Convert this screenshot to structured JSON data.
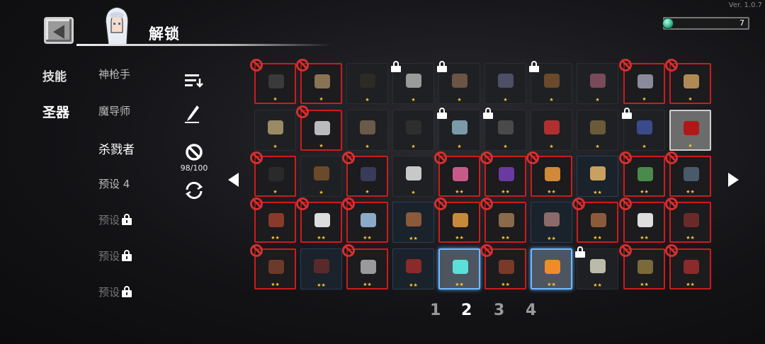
{
  "version": "Ver. 1.0.7",
  "header": {
    "title": "解锁"
  },
  "currency": {
    "count": "7"
  },
  "categories": [
    {
      "label": "技能",
      "active": false
    },
    {
      "label": "圣器",
      "active": true
    }
  ],
  "presets": [
    {
      "label": "神枪手",
      "locked": false
    },
    {
      "label": "魔导师",
      "locked": false
    },
    {
      "label": "杀戮者",
      "locked": false,
      "active": true
    },
    {
      "label": "预设 4",
      "locked": false
    },
    {
      "label": "预设",
      "locked": true
    },
    {
      "label": "预设",
      "locked": true
    },
    {
      "label": "预设",
      "locked": true
    }
  ],
  "tools": {
    "ban_count": "98/100"
  },
  "pages": [
    "1",
    "2",
    "3",
    "4"
  ],
  "active_page": "2",
  "grid": {
    "rows": [
      [
        {
          "state": "banned",
          "stars": "★",
          "color": "#3a3a3a",
          "icon": "helmet-icon"
        },
        {
          "state": "banned",
          "stars": "★",
          "color": "#8a7355",
          "icon": "horn-icon"
        },
        {
          "state": "normal",
          "stars": "★",
          "color": "#2e2a24",
          "icon": "necklace-icon"
        },
        {
          "state": "locked",
          "stars": "★",
          "color": "#9a9a9a",
          "icon": "orb-icon"
        },
        {
          "state": "locked",
          "stars": "★",
          "color": "#6b5544",
          "icon": "pouch-icon"
        },
        {
          "state": "normal",
          "stars": "★",
          "color": "#4e4e66",
          "icon": "feather-icon"
        },
        {
          "state": "locked",
          "stars": "★",
          "color": "#6a4a2a",
          "icon": "chest-icon"
        },
        {
          "state": "normal",
          "stars": "★",
          "color": "#7a4a5a",
          "icon": "meat-icon"
        },
        {
          "state": "banned",
          "stars": "★",
          "color": "#8a8a9a",
          "icon": "claw-icon"
        },
        {
          "state": "banned",
          "stars": "★",
          "color": "#b08a55",
          "icon": "bone-icon"
        }
      ],
      [
        {
          "state": "normal",
          "stars": "★",
          "color": "#9a8a66",
          "icon": "dagger-icon"
        },
        {
          "state": "banned",
          "stars": "★",
          "color": "#bbbbbb",
          "icon": "fur-icon"
        },
        {
          "state": "normal",
          "stars": "★",
          "color": "#6a5a4a",
          "icon": "scroll-icon"
        },
        {
          "state": "normal",
          "stars": "★",
          "color": "#2e2e2e",
          "icon": "pan-icon"
        },
        {
          "state": "locked",
          "stars": "★",
          "color": "#7a9aaa",
          "icon": "band-icon"
        },
        {
          "state": "locked",
          "stars": "★",
          "color": "#4a4a4a",
          "icon": "bird-icon"
        },
        {
          "state": "normal",
          "stars": "★",
          "color": "#b03030",
          "icon": "magnet-icon"
        },
        {
          "state": "normal",
          "stars": "★",
          "color": "#6a5a3a",
          "icon": "arrow-icon"
        },
        {
          "state": "locked",
          "stars": "★",
          "color": "#3a4a8a",
          "icon": "banner-icon"
        },
        {
          "state": "gray",
          "stars": "★",
          "color": "#b01818",
          "icon": "heart-icon"
        }
      ],
      [
        {
          "state": "banned",
          "stars": "★",
          "color": "#2a2a2a",
          "icon": "hook-icon"
        },
        {
          "state": "normal",
          "stars": "★",
          "color": "#6a4a2a",
          "icon": "seed-icon"
        },
        {
          "state": "banned",
          "stars": "★",
          "color": "#3a3a5a",
          "icon": "bat-icon"
        },
        {
          "state": "normal",
          "stars": "★",
          "color": "#c8c8c8",
          "icon": "bone-icon"
        },
        {
          "state": "banned",
          "stars": "★★",
          "color": "#c85a8a",
          "icon": "crystal-icon"
        },
        {
          "state": "banned",
          "stars": "★★",
          "color": "#6a3aa0",
          "icon": "eggplant-icon"
        },
        {
          "state": "banned",
          "stars": "★★",
          "color": "#d08a3a",
          "icon": "flask-icon"
        },
        {
          "state": "blue",
          "stars": "★★",
          "color": "#c8a060",
          "icon": "shell-icon"
        },
        {
          "state": "banned",
          "stars": "★★",
          "color": "#4a8a4a",
          "icon": "book-icon"
        },
        {
          "state": "banned",
          "stars": "★★",
          "color": "#4a5a6a",
          "icon": "robot-icon"
        }
      ],
      [
        {
          "state": "banned",
          "stars": "★★",
          "color": "#8a3a2a",
          "icon": "shield-icon"
        },
        {
          "state": "banned",
          "stars": "★★",
          "color": "#dddddd",
          "icon": "dice-icon"
        },
        {
          "state": "banned",
          "stars": "★★",
          "color": "#8aaac8",
          "icon": "ice-icon"
        },
        {
          "state": "blue",
          "stars": "★★",
          "color": "#8a5a3a",
          "icon": "cape-icon"
        },
        {
          "state": "banned",
          "stars": "★★",
          "color": "#c88a3a",
          "icon": "coin-icon"
        },
        {
          "state": "banned",
          "stars": "★★",
          "color": "#8a6a4a",
          "icon": "sword-icon"
        },
        {
          "state": "blue",
          "stars": "★★",
          "color": "#8a6a6a",
          "icon": "feather-icon"
        },
        {
          "state": "banned",
          "stars": "★★",
          "color": "#8a5a3a",
          "icon": "lizard-icon"
        },
        {
          "state": "banned",
          "stars": "★★",
          "color": "#dddddd",
          "icon": "snowflake-icon"
        },
        {
          "state": "banned",
          "stars": "★★",
          "color": "#6a2a2a",
          "icon": "cauldron-icon"
        }
      ],
      [
        {
          "state": "banned",
          "stars": "★★",
          "color": "#6a3a2a",
          "icon": "gauntlet-icon"
        },
        {
          "state": "blue",
          "stars": "★★",
          "color": "#5a2a2a",
          "icon": "beetle-icon"
        },
        {
          "state": "banned",
          "stars": "★★",
          "color": "#9a9a9a",
          "icon": "skull-icon"
        },
        {
          "state": "blue",
          "stars": "★★",
          "color": "#8a2a2a",
          "icon": "scarf-icon"
        },
        {
          "state": "glow",
          "stars": "★★",
          "color": "#5ae0d8",
          "icon": "gem-icon"
        },
        {
          "state": "banned",
          "stars": "★★",
          "color": "#7a3a2a",
          "icon": "steak-icon"
        },
        {
          "state": "glow",
          "stars": "★★",
          "color": "#f08a2a",
          "icon": "missile-icon"
        },
        {
          "state": "locked",
          "stars": "★★",
          "color": "#bbbbaa",
          "icon": "map-icon"
        },
        {
          "state": "banned",
          "stars": "★★",
          "color": "#7a6a3a",
          "icon": "boots-icon"
        },
        {
          "state": "banned",
          "stars": "★★",
          "color": "#8a2a2a",
          "icon": "tentacle-icon"
        }
      ]
    ]
  }
}
